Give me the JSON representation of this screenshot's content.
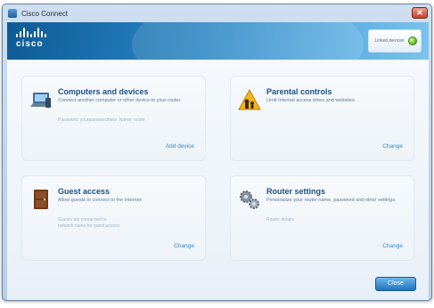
{
  "window": {
    "title": "Cisco Connect"
  },
  "header": {
    "logo_text": "cisco",
    "status": {
      "text": "Linked devices"
    }
  },
  "panels": [
    {
      "title": "Computers and devices",
      "description": "Connect another computer or other device to your router.",
      "info": "Password: yourpasswordhere. Name: router",
      "action_label": "Add device",
      "icon": "computer-icon"
    },
    {
      "title": "Parental controls",
      "description": "Limit Internet access times and websites.",
      "info": "",
      "action_label": "Change",
      "icon": "parental-controls-icon"
    },
    {
      "title": "Guest access",
      "description": "Allow guests to connect to the Internet.",
      "info": "Guests are connected to\nnetwork name for guest access",
      "action_label": "Change",
      "icon": "guest-door-icon"
    },
    {
      "title": "Router settings",
      "description": "Personalize your router name, password and other settings.",
      "info": "Router details",
      "action_label": "Change",
      "icon": "router-gears-icon"
    }
  ],
  "footer": {
    "close_label": "Close"
  },
  "colors": {
    "header_start": "#0d5a96",
    "header_end": "#7cc3ec",
    "panel_title": "#1d4f86",
    "link": "#3a86c8",
    "status_ok": "#54b41e"
  }
}
